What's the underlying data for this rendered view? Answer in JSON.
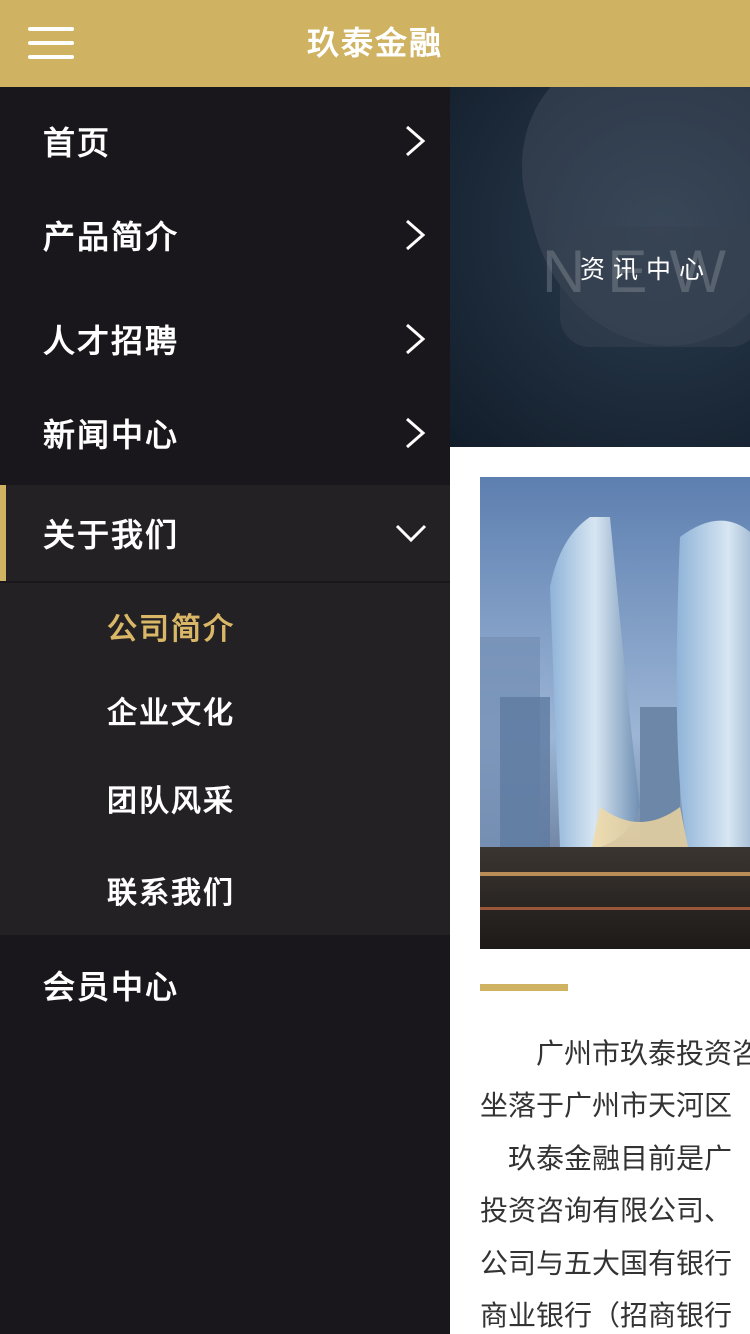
{
  "header": {
    "title": "玖泰金融",
    "menu_icon": "hamburger-icon"
  },
  "drawer": {
    "items": [
      {
        "label": "首页"
      },
      {
        "label": "产品简介"
      },
      {
        "label": "人才招聘"
      },
      {
        "label": "新闻中心"
      },
      {
        "label": "关于我们",
        "expanded": true
      },
      {
        "label": "会员中心"
      }
    ],
    "sub_items": [
      {
        "label": "公司简介",
        "current": true
      },
      {
        "label": "企业文化"
      },
      {
        "label": "团队风采"
      },
      {
        "label": "联系我们"
      }
    ],
    "accent_color": "#cfb262"
  },
  "content": {
    "banner": {
      "bg_text": "NEWS",
      "title": "资讯中心"
    },
    "paragraphs": [
      "　　广州市玖泰投资咨",
      "坐落于广州市天河区",
      "　玖泰金融目前是广",
      "投资咨询有限公司、",
      "公司与五大国有银行",
      "商业银行（招商银行"
    ]
  }
}
